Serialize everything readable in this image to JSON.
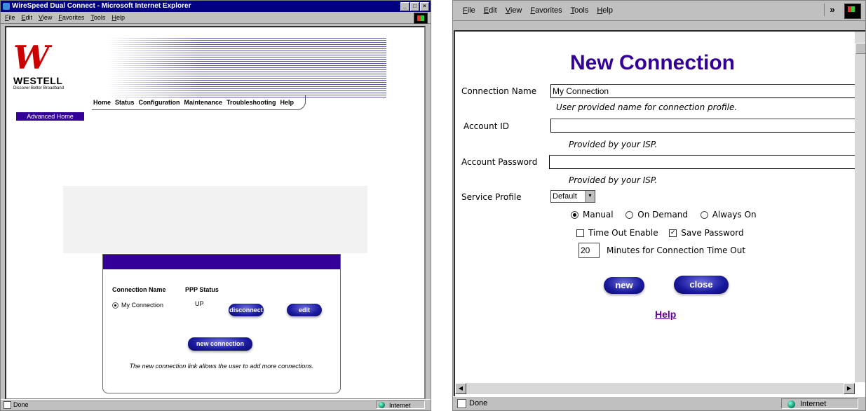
{
  "left_window": {
    "title": "WireSpeed Dual Connect - Microsoft Internet Explorer",
    "menu": [
      "File",
      "Edit",
      "View",
      "Favorites",
      "Tools",
      "Help"
    ],
    "logo": {
      "brand": "WESTELL",
      "tagline": "Discover Better Broadband"
    },
    "nav": [
      "Home",
      "Status",
      "Configuration",
      "Maintenance",
      "Troubleshooting",
      "Help"
    ],
    "advanced_home": "Advanced Home",
    "table": {
      "col_name": "Connection Name",
      "col_status": "PPP Status",
      "row": {
        "name": "My Connection",
        "status": "UP"
      }
    },
    "buttons": {
      "disconnect": "disconnect",
      "edit": "edit",
      "new_connection": "new connection"
    },
    "note": "The new connection link allows the user to add more connections.",
    "status": {
      "text": "Done",
      "zone": "Internet"
    }
  },
  "right_window": {
    "menu": [
      "File",
      "Edit",
      "View",
      "Favorites",
      "Tools",
      "Help"
    ],
    "chevron": "»",
    "title": "New Connection",
    "fields": {
      "connection_name": {
        "label": "Connection Name",
        "value": "My Connection",
        "hint": "User provided name for connection profile."
      },
      "account_id": {
        "label": "Account ID",
        "value": "",
        "hint": "Provided by your ISP."
      },
      "account_password": {
        "label": "Account Password",
        "value": "",
        "hint": "Provided by your ISP."
      },
      "service_profile": {
        "label": "Service Profile",
        "value": "Default"
      }
    },
    "connect_modes": {
      "manual": "Manual",
      "on_demand": "On Demand",
      "always_on": "Always On",
      "selected": "Manual"
    },
    "checkboxes": {
      "time_out_enable": "Time Out Enable",
      "save_password": "Save Password"
    },
    "timeout": {
      "value": "20",
      "label": "Minutes for Connection Time Out"
    },
    "buttons": {
      "new": "new",
      "close": "close"
    },
    "help": "Help",
    "status": {
      "text": "Done",
      "zone": "Internet"
    }
  }
}
